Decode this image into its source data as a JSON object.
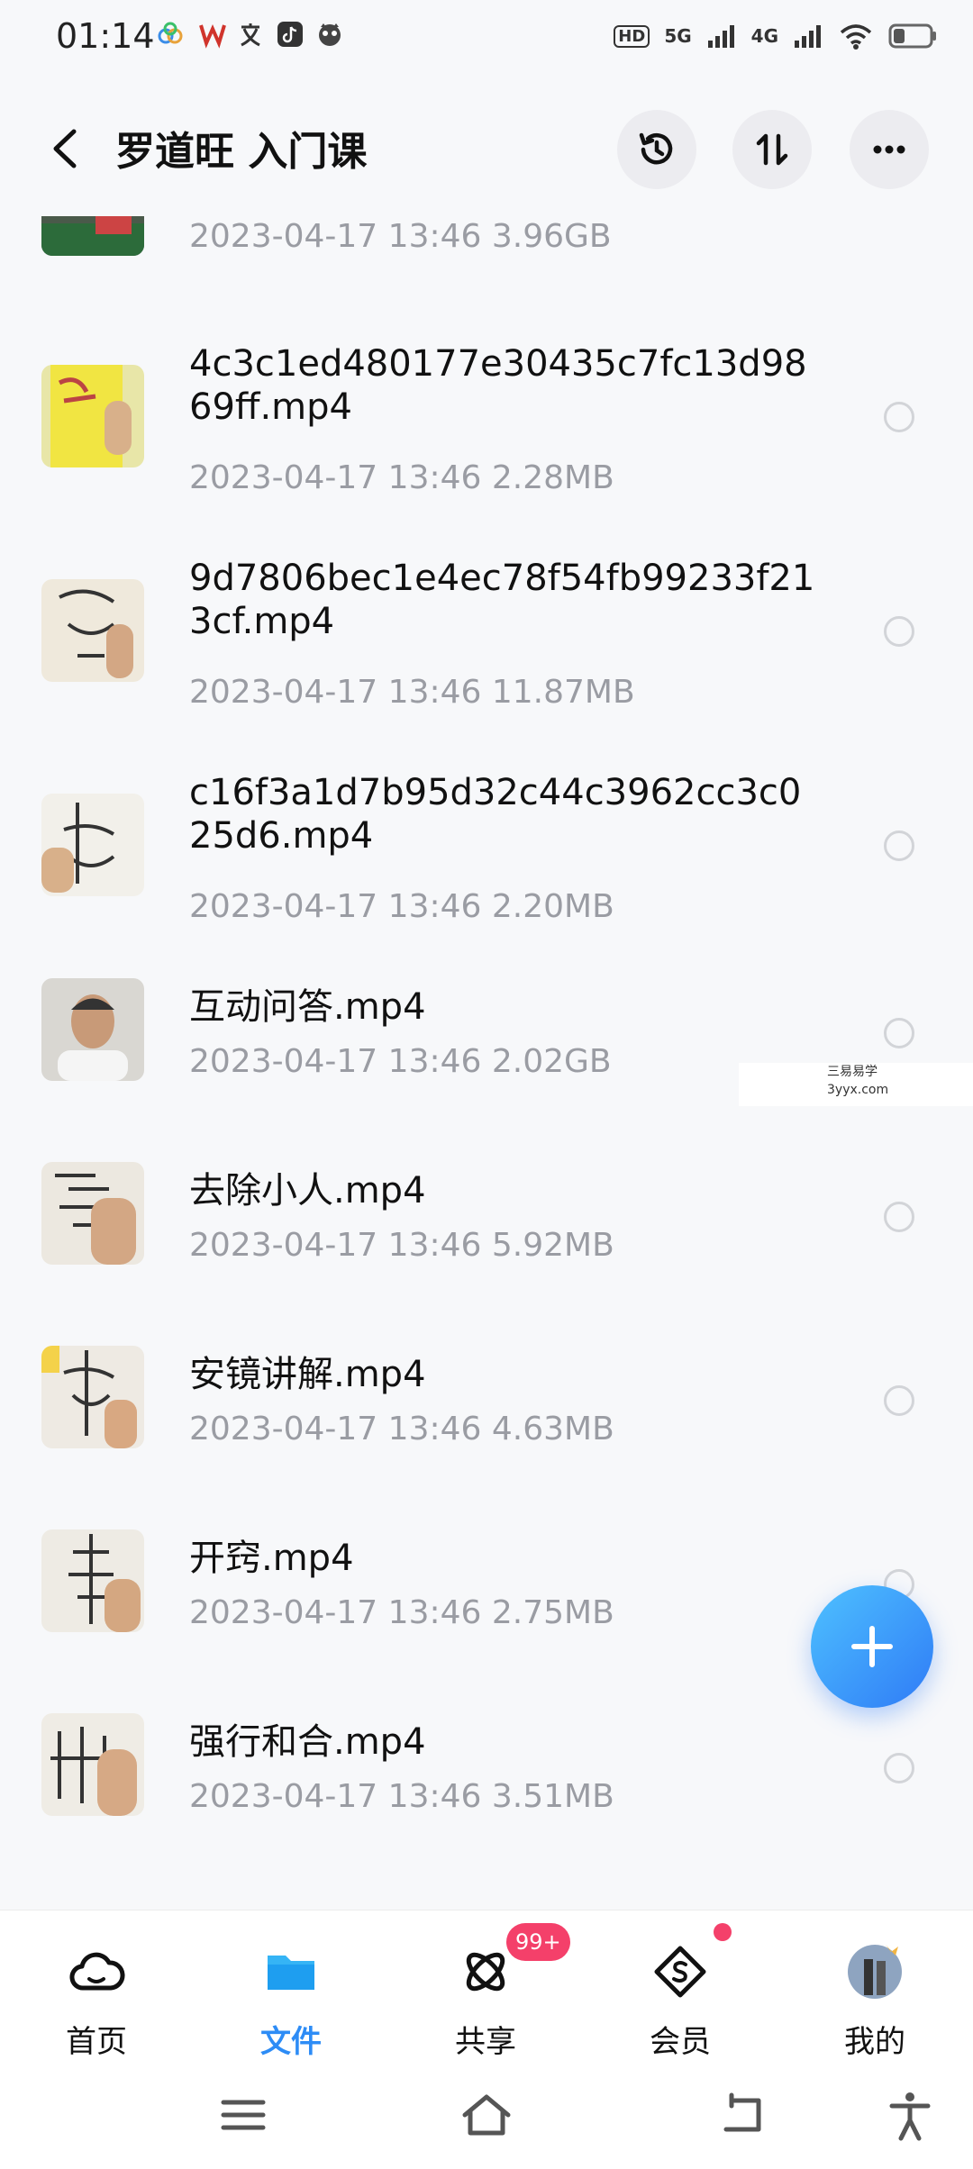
{
  "status_bar": {
    "time": "01:14",
    "icons": [
      "cloud-app-icon",
      "wps-icon",
      "translate-icon",
      "tiktok-icon",
      "cat-app-icon"
    ],
    "hd_label": "HD",
    "network_5g": "5G",
    "network_4g": "4G"
  },
  "header": {
    "title": "罗道旺 入门课",
    "back_icon": "chevron-left-icon",
    "history_icon": "history-icon",
    "sort_icon": "sort-icon",
    "more_icon": "more-icon"
  },
  "files": [
    {
      "name": "",
      "date": "2023-04-17  13:46",
      "size": "3.96GB",
      "thumb": "partial-video-thumb"
    },
    {
      "name": "4c3c1ed480177e30435c7fc13d9869ff.mp4",
      "date": "2023-04-17  13:46",
      "size": "2.28MB",
      "thumb": "yellow-paper-thumb"
    },
    {
      "name": "9d7806bec1e4ec78f54fb99233f213cf.mp4",
      "date": "2023-04-17  13:46",
      "size": "11.87MB",
      "thumb": "talisman-thumb"
    },
    {
      "name": "c16f3a1d7b95d32c44c3962cc3c025d6.mp4",
      "date": "2023-04-17  13:46",
      "size": "2.20MB",
      "thumb": "talisman-thumb"
    },
    {
      "name": "互动问答.mp4",
      "date": "2023-04-17  13:46",
      "size": "2.02GB",
      "thumb": "person-thumb"
    },
    {
      "name": "去除小人.mp4",
      "date": "2023-04-17  13:46",
      "size": "5.92MB",
      "thumb": "talisman-thumb"
    },
    {
      "name": "安镜讲解.mp4",
      "date": "2023-04-17  13:46",
      "size": "4.63MB",
      "thumb": "talisman-thumb"
    },
    {
      "name": "开窍.mp4",
      "date": "2023-04-17  13:46",
      "size": "2.75MB",
      "thumb": "talisman-thumb"
    },
    {
      "name": "强行和合.mp4",
      "date": "2023-04-17  13:46",
      "size": "3.51MB",
      "thumb": "talisman-thumb"
    }
  ],
  "watermark": {
    "line1": "三易易学",
    "line2": "3yyx.com"
  },
  "fab": {
    "icon": "plus-icon"
  },
  "tabs": [
    {
      "label": "首页",
      "icon": "cloud-icon",
      "active": false
    },
    {
      "label": "文件",
      "icon": "folder-icon",
      "active": true
    },
    {
      "label": "共享",
      "icon": "share-orbit-icon",
      "active": false
    },
    {
      "label": "会员",
      "icon": "vip-diamond-icon",
      "active": false
    },
    {
      "label": "我的",
      "icon": "avatar-icon",
      "active": false
    }
  ],
  "share_badge": "99+",
  "colors": {
    "accent": "#2d8cf6",
    "badge": "#f4406a",
    "meta": "#9a9ca3"
  },
  "nav": [
    "menu-icon",
    "home-icon",
    "back-icon",
    "accessibility-icon"
  ]
}
